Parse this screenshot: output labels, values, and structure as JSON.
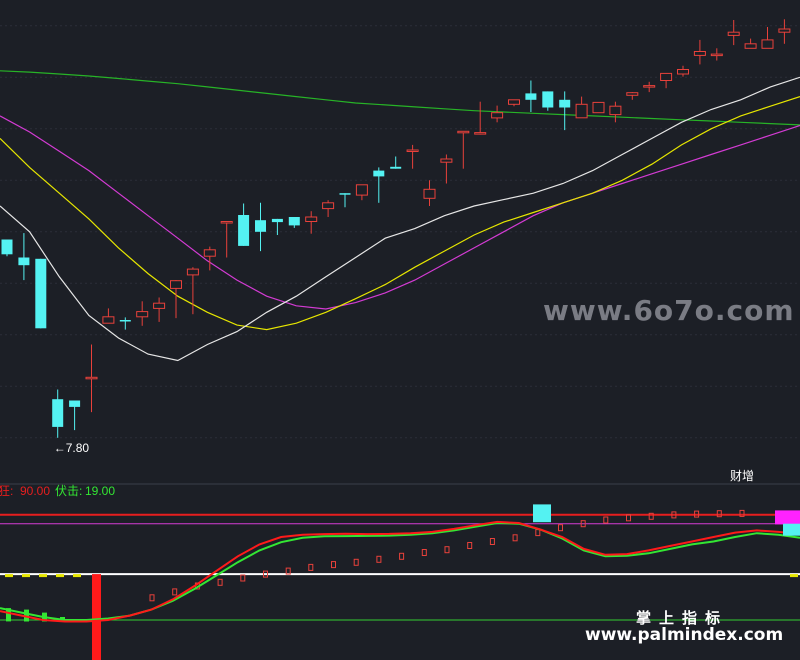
{
  "colors": {
    "background": "#1c1f26",
    "up_candle": "#e8413b",
    "down_candle": "#54f2f2",
    "ma_white": "#e6e6e6",
    "ma_yellow": "#e6e600",
    "ma_magenta": "#d33bd3",
    "ma_green": "#27b327",
    "fast_line": "#ff1a1a",
    "slow_line": "#33e633",
    "upper_level": "#e61e1e",
    "mid_level": "#ffffff",
    "lower_level": "#33cc33",
    "tag_yellow": "#e6e600",
    "tag_magenta": "#ff22ff"
  },
  "chart_data": [
    {
      "type": "candlestick",
      "title": "",
      "low_annotation": "←7.80",
      "marker_label": "财增",
      "ylim": [
        7.6,
        12.4
      ],
      "grid": true,
      "candles": [
        {
          "o": 10.88,
          "h": 10.88,
          "l": 10.62,
          "c": 10.65
        },
        {
          "o": 10.6,
          "h": 10.98,
          "l": 10.25,
          "c": 10.48
        },
        {
          "o": 10.58,
          "h": 10.58,
          "l": 9.5,
          "c": 9.5
        },
        {
          "o": 8.4,
          "h": 8.55,
          "l": 7.8,
          "c": 7.97
        },
        {
          "o": 8.38,
          "h": 8.33,
          "l": 7.92,
          "c": 8.28
        },
        {
          "o": 8.73,
          "h": 9.25,
          "l": 8.2,
          "c": 8.74
        },
        {
          "o": 9.58,
          "h": 9.81,
          "l": 9.6,
          "c": 9.68
        },
        {
          "o": 9.63,
          "h": 9.67,
          "l": 9.48,
          "c": 9.62
        },
        {
          "o": 9.68,
          "h": 9.92,
          "l": 9.54,
          "c": 9.76
        },
        {
          "o": 9.81,
          "h": 9.98,
          "l": 9.6,
          "c": 9.89
        },
        {
          "o": 10.12,
          "h": 10.25,
          "l": 9.66,
          "c": 10.24
        },
        {
          "o": 10.33,
          "h": 10.45,
          "l": 9.72,
          "c": 10.42
        },
        {
          "o": 10.62,
          "h": 10.77,
          "l": 10.4,
          "c": 10.72
        },
        {
          "o": 11.15,
          "h": 11.15,
          "l": 10.6,
          "c": 11.16
        },
        {
          "o": 11.26,
          "h": 11.44,
          "l": 10.88,
          "c": 10.78
        },
        {
          "o": 11.18,
          "h": 11.45,
          "l": 10.7,
          "c": 11.0
        },
        {
          "o": 11.2,
          "h": 11.2,
          "l": 10.95,
          "c": 11.15
        },
        {
          "o": 11.23,
          "h": 11.16,
          "l": 11.06,
          "c": 11.1
        },
        {
          "o": 11.16,
          "h": 11.32,
          "l": 10.97,
          "c": 11.23
        },
        {
          "o": 11.36,
          "h": 11.49,
          "l": 11.23,
          "c": 11.45
        },
        {
          "o": 11.6,
          "h": 11.6,
          "l": 11.38,
          "c": 11.58
        },
        {
          "o": 11.57,
          "h": 11.7,
          "l": 11.49,
          "c": 11.73
        },
        {
          "o": 11.95,
          "h": 12.0,
          "l": 11.45,
          "c": 11.86
        },
        {
          "o": 12.01,
          "h": 12.17,
          "l": 12.0,
          "c": 11.98
        },
        {
          "o": 12.25,
          "h": 12.35,
          "l": 11.98,
          "c": 12.27
        },
        {
          "o": 11.52,
          "h": 11.8,
          "l": 11.4,
          "c": 11.66
        },
        {
          "o": 12.08,
          "h": 12.2,
          "l": 11.75,
          "c": 12.13
        },
        {
          "o": 12.54,
          "h": 12.54,
          "l": 11.98,
          "c": 12.56
        },
        {
          "o": 12.54,
          "h": 13.02,
          "l": 12.51,
          "c": 12.54
        },
        {
          "o": 12.77,
          "h": 12.96,
          "l": 12.7,
          "c": 12.85
        },
        {
          "o": 12.98,
          "h": 13.05,
          "l": 12.95,
          "c": 13.05
        },
        {
          "o": 13.15,
          "h": 13.35,
          "l": 12.86,
          "c": 13.05
        },
        {
          "o": 13.18,
          "h": 13.18,
          "l": 12.88,
          "c": 12.93
        },
        {
          "o": 13.05,
          "h": 13.18,
          "l": 12.58,
          "c": 12.93
        },
        {
          "o": 12.77,
          "h": 13.1,
          "l": 12.78,
          "c": 12.98
        },
        {
          "o": 12.85,
          "h": 13.0,
          "l": 12.93,
          "c": 13.01
        },
        {
          "o": 12.82,
          "h": 13.02,
          "l": 12.7,
          "c": 12.95
        },
        {
          "o": 13.12,
          "h": 13.17,
          "l": 13.05,
          "c": 13.16
        },
        {
          "o": 13.27,
          "h": 13.33,
          "l": 13.17,
          "c": 13.27
        },
        {
          "o": 13.35,
          "h": 13.46,
          "l": 13.23,
          "c": 13.46
        },
        {
          "o": 13.45,
          "h": 13.58,
          "l": 13.41,
          "c": 13.52
        },
        {
          "o": 13.74,
          "h": 13.98,
          "l": 13.6,
          "c": 13.8
        },
        {
          "o": 13.76,
          "h": 13.85,
          "l": 13.66,
          "c": 13.76
        },
        {
          "o": 14.05,
          "h": 14.29,
          "l": 13.9,
          "c": 14.1
        },
        {
          "o": 13.85,
          "h": 14.0,
          "l": 13.88,
          "c": 13.92
        },
        {
          "o": 13.85,
          "h": 14.18,
          "l": 13.85,
          "c": 13.98
        },
        {
          "o": 14.1,
          "h": 14.3,
          "l": 13.92,
          "c": 14.15
        }
      ],
      "ma_white": [
        11.4,
        11.0,
        10.3,
        9.7,
        9.35,
        9.1,
        9.0,
        9.25,
        9.45,
        9.75,
        10.0,
        10.3,
        10.6,
        10.9,
        11.05,
        11.25,
        11.4,
        11.5,
        11.6,
        11.75,
        11.95,
        12.2,
        12.45,
        12.7,
        12.9,
        13.05,
        13.25,
        13.4
      ],
      "ma_yellow": [
        12.45,
        12.0,
        11.6,
        11.2,
        10.75,
        10.35,
        10.0,
        9.75,
        9.55,
        9.48,
        9.58,
        9.75,
        9.96,
        10.18,
        10.45,
        10.7,
        10.95,
        11.15,
        11.3,
        11.45,
        11.6,
        11.8,
        12.05,
        12.35,
        12.6,
        12.8,
        12.95,
        13.1
      ],
      "ma_magenta": [
        12.8,
        12.55,
        12.25,
        11.95,
        11.6,
        11.25,
        10.9,
        10.55,
        10.25,
        10.0,
        9.85,
        9.8,
        9.9,
        10.05,
        10.25,
        10.5,
        10.75,
        11.0,
        11.25,
        11.45,
        11.6,
        11.75,
        11.9,
        12.05,
        12.2,
        12.35,
        12.5,
        12.65
      ],
      "ma_green": [
        13.5,
        13.48,
        13.45,
        13.42,
        13.38,
        13.34,
        13.3,
        13.25,
        13.2,
        13.15,
        13.1,
        13.05,
        13.0,
        12.97,
        12.94,
        12.91,
        12.88,
        12.86,
        12.84,
        12.82,
        12.8,
        12.78,
        12.76,
        12.74,
        12.72,
        12.7,
        12.68,
        12.66
      ]
    },
    {
      "type": "line",
      "title": "",
      "legend": [
        {
          "label": "狂:",
          "value": "90.00",
          "color": "#e61e1e"
        },
        {
          "label": "伏击:",
          "value": "19.00",
          "color": "#33e633"
        }
      ],
      "ylim": [
        0,
        100
      ],
      "levels": {
        "upper": 90,
        "magenta": 84,
        "mid": 50,
        "lower": 19
      },
      "fast": [
        25,
        22,
        19,
        18,
        18,
        19,
        22,
        26,
        33,
        42,
        52,
        62,
        70,
        75,
        76.5,
        77,
        77.2,
        77,
        77.1,
        77.6,
        78.5,
        80.5,
        83,
        85.2,
        84.5,
        80,
        75,
        67,
        63,
        63.5,
        66,
        69,
        72,
        75,
        78,
        79.5,
        78.5,
        77
      ],
      "slow": [
        27,
        24,
        21,
        19,
        19,
        20,
        22,
        26,
        32,
        40,
        49,
        58,
        66,
        71.5,
        74.5,
        75.5,
        75.6,
        75.8,
        76,
        76.6,
        77.5,
        79.5,
        82,
        84.5,
        84,
        80,
        74,
        66,
        62,
        62.4,
        64,
        67,
        70,
        72,
        75,
        77.6,
        76.5,
        74.5
      ],
      "steps": [
        36,
        40,
        44,
        46.5,
        49.4,
        52,
        54,
        56.5,
        58.4,
        60,
        62,
        64,
        66.6,
        68.5,
        71.3,
        74,
        76.5,
        80,
        83.3,
        86,
        88.5,
        90,
        91,
        92,
        92.5,
        92.8,
        93
      ],
      "green_bars": [
        27,
        26,
        24,
        21,
        18
      ],
      "red_bar": {
        "top": 50,
        "bottom": 0
      },
      "cyan_tag": {
        "top": 97,
        "bottom": 85
      }
    }
  ],
  "watermarks": {
    "site_large": "www.6o7o.com",
    "brand_cn": "掌上指标",
    "site_small": "www.palmindex.com"
  }
}
